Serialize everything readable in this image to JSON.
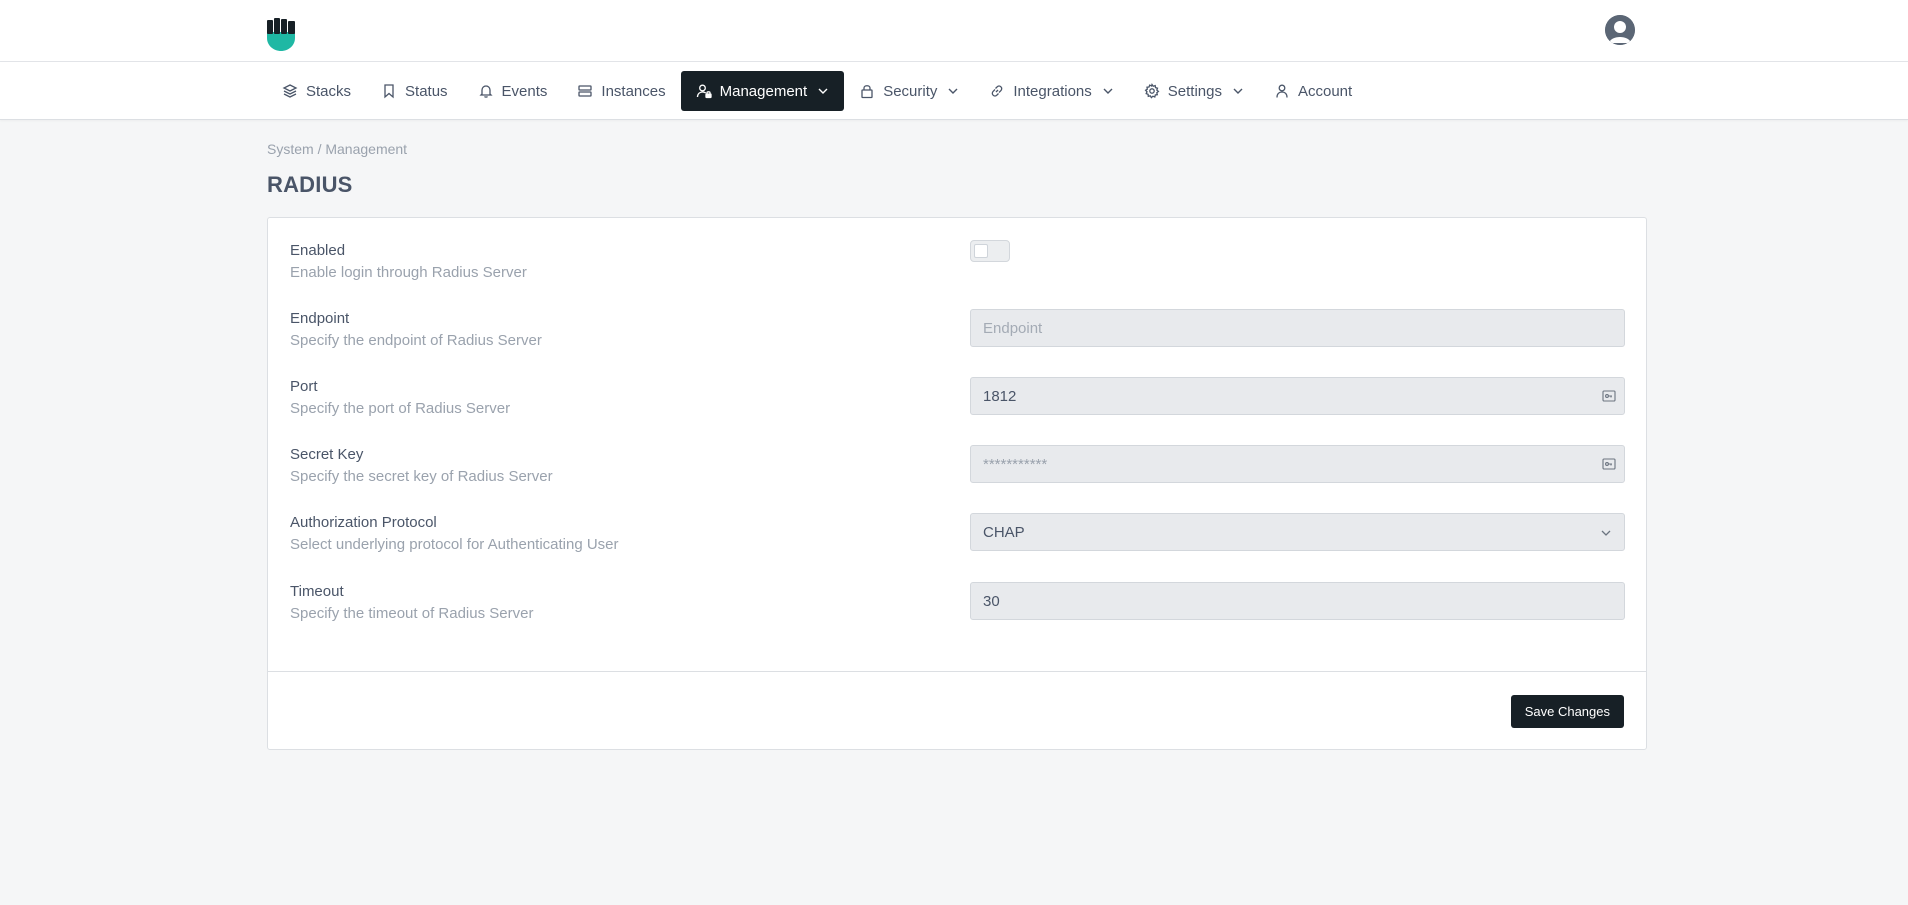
{
  "nav": {
    "items": [
      {
        "label": "Stacks",
        "icon": "layers-icon",
        "active": false,
        "dropdown": false
      },
      {
        "label": "Status",
        "icon": "bookmark-icon",
        "active": false,
        "dropdown": false
      },
      {
        "label": "Events",
        "icon": "bell-icon",
        "active": false,
        "dropdown": false
      },
      {
        "label": "Instances",
        "icon": "server-icon",
        "active": false,
        "dropdown": false
      },
      {
        "label": "Management",
        "icon": "user-lock-icon",
        "active": true,
        "dropdown": true
      },
      {
        "label": "Security",
        "icon": "lock-icon",
        "active": false,
        "dropdown": true
      },
      {
        "label": "Integrations",
        "icon": "link-icon",
        "active": false,
        "dropdown": true
      },
      {
        "label": "Settings",
        "icon": "gear-icon",
        "active": false,
        "dropdown": true
      },
      {
        "label": "Account",
        "icon": "user-icon",
        "active": false,
        "dropdown": false
      }
    ]
  },
  "breadcrumb": "System / Management",
  "page": {
    "title": "RADIUS"
  },
  "form": {
    "enabled": {
      "label": "Enabled",
      "description": "Enable login through Radius Server",
      "value": false
    },
    "endpoint": {
      "label": "Endpoint",
      "description": "Specify the endpoint of Radius Server",
      "value": "",
      "placeholder": "Endpoint"
    },
    "port": {
      "label": "Port",
      "description": "Specify the port of Radius Server",
      "value": "1812"
    },
    "secret_key": {
      "label": "Secret Key",
      "description": "Specify the secret key of Radius Server",
      "value": "***********"
    },
    "auth_protocol": {
      "label": "Authorization Protocol",
      "description": "Select underlying protocol for Authenticating User",
      "value": "CHAP"
    },
    "timeout": {
      "label": "Timeout",
      "description": "Specify the timeout of Radius Server",
      "value": "30"
    }
  },
  "actions": {
    "save_label": "Save Changes"
  },
  "colors": {
    "brand": "#1fb8a4",
    "dark": "#172026",
    "page_bg": "#f5f6f7"
  }
}
